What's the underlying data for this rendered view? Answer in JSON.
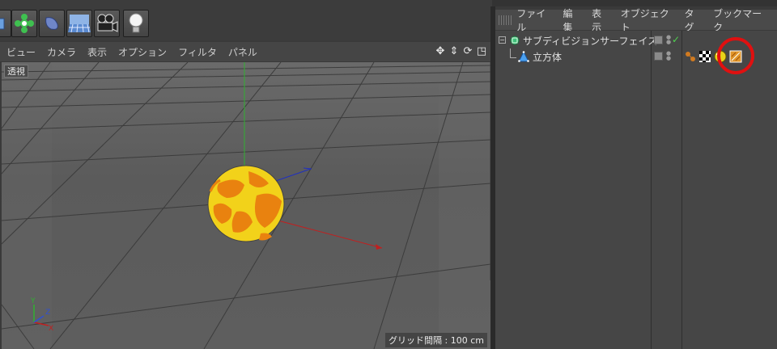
{
  "viewport": {
    "menu": [
      "ビュー",
      "カメラ",
      "表示",
      "オプション",
      "フィルタ",
      "パネル"
    ],
    "label": "透視",
    "grid_info": "グリッド間隔 : 100 cm",
    "nav_icons": [
      "move-view-icon",
      "scroll-view-icon",
      "rotate-view-icon",
      "maximize-view-icon"
    ]
  },
  "toolbar": {
    "icons": [
      "cube-tool-icon",
      "cloner-tool-icon",
      "deformer-tool-icon",
      "floor-scene-icon",
      "camera-tool-icon",
      "light-tool-icon"
    ]
  },
  "object_manager": {
    "menu": [
      "ファイル",
      "編集",
      "表示",
      "オブジェクト",
      "タグ",
      "ブックマーク"
    ],
    "rows": [
      {
        "name": "サブディビジョンサーフェイス",
        "enabled": "✓"
      },
      {
        "name": "立方体"
      }
    ],
    "tags": [
      "phong-tag-icon",
      "texture-checker-tag-icon",
      "material-sphere-tag-icon",
      "uvw-tag-icon"
    ]
  },
  "colors": {
    "sphere_yellow": "#f2d21a",
    "sphere_orange": "#e9820f",
    "axis_x": "#c02020",
    "axis_y": "#30b030",
    "axis_z": "#2030c0",
    "highlight": "#e01010"
  }
}
